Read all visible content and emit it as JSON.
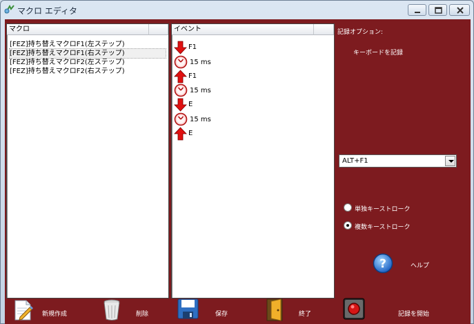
{
  "window": {
    "title": "マクロ エディタ",
    "icons": {
      "app": "macro-app-icon",
      "minimize": "minimize-icon",
      "maximize": "maximize-icon",
      "close": "close-icon"
    }
  },
  "macro_panel": {
    "header": "マクロ",
    "items": [
      {
        "label": "[FEZ]持ち替えマクロF1(左ステップ)",
        "selected": false
      },
      {
        "label": "[FEZ]持ち替えマクロF1(右ステップ)",
        "selected": true
      },
      {
        "label": "[FEZ]持ち替えマクロF2(左ステップ)",
        "selected": false
      },
      {
        "label": "[FEZ]持ち替えマクロF2(右ステップ)",
        "selected": false
      }
    ]
  },
  "event_panel": {
    "header": "イベント",
    "items": [
      {
        "type": "key-down",
        "icon": "arrow-down-icon",
        "label": "F1"
      },
      {
        "type": "wait",
        "icon": "clock-icon",
        "label": "15 ms"
      },
      {
        "type": "key-up",
        "icon": "arrow-up-icon",
        "label": "F1"
      },
      {
        "type": "wait",
        "icon": "clock-icon",
        "label": "15 ms"
      },
      {
        "type": "key-down",
        "icon": "arrow-down-icon",
        "label": "E"
      },
      {
        "type": "wait",
        "icon": "clock-icon",
        "label": "15 ms"
      },
      {
        "type": "key-up",
        "icon": "arrow-up-icon",
        "label": "E"
      }
    ]
  },
  "options": {
    "title": "記録オプション:",
    "keyboard_label": "キーボードを記録",
    "hotkey_value": "ALT+F1",
    "radio_single": "単独キーストローク",
    "radio_multiple": "複数キーストローク",
    "selected_radio": "multiple",
    "help_label": "ヘルプ"
  },
  "toolbar": {
    "new_label": "新規作成",
    "delete_label": "削除",
    "save_label": "保存",
    "exit_label": "終了",
    "record_label": "記録を開始"
  },
  "colors": {
    "client_bg": "#7d1b1f",
    "arrow_red": "#e01010"
  }
}
